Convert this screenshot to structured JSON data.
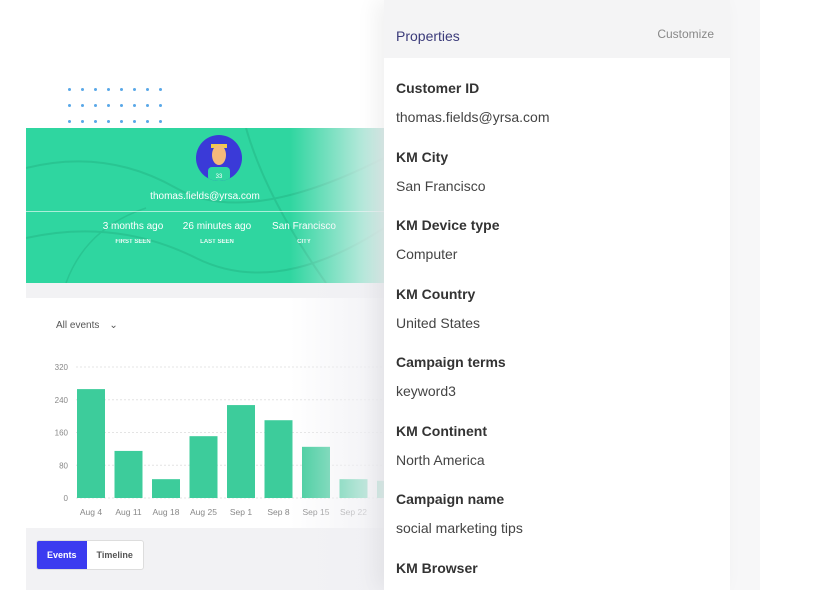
{
  "profile": {
    "email": "thomas.fields@yrsa.com",
    "avatar_badge": "33",
    "stats": [
      {
        "value": "3 months ago",
        "label": "FIRST SEEN"
      },
      {
        "value": "26 minutes ago",
        "label": "LAST SEEN"
      },
      {
        "value": "San Francisco",
        "label": "CITY"
      }
    ]
  },
  "filter": {
    "selected": "All events"
  },
  "tabs": [
    {
      "label": "Events",
      "active": true
    },
    {
      "label": "Timeline",
      "active": false
    }
  ],
  "colors": {
    "accent": "#3b3bf0",
    "hero": "#2fd6a0",
    "bar": "#3dcc9b"
  },
  "chart_data": {
    "type": "bar",
    "categories": [
      "Aug 4",
      "Aug 11",
      "Aug 18",
      "Aug 25",
      "Sep 1",
      "Sep 8",
      "Sep 15",
      "Sep 22",
      "Se"
    ],
    "values": [
      266,
      115,
      46,
      151,
      227,
      190,
      125,
      46,
      42
    ],
    "ylim": [
      0,
      320
    ],
    "yticks": [
      0,
      80,
      160,
      240,
      320
    ],
    "grid": true
  },
  "panel": {
    "title": "Properties",
    "customize": "Customize",
    "properties": [
      {
        "key": "Customer ID",
        "value": "thomas.fields@yrsa.com"
      },
      {
        "key": "KM City",
        "value": "San Francisco"
      },
      {
        "key": "KM Device type",
        "value": "Computer"
      },
      {
        "key": "KM Country",
        "value": "United States"
      },
      {
        "key": "Campaign terms",
        "value": "keyword3"
      },
      {
        "key": "KM Continent",
        "value": "North America"
      },
      {
        "key": "Campaign name",
        "value": "social marketing tips"
      },
      {
        "key": "KM Browser",
        "value": ""
      }
    ]
  }
}
